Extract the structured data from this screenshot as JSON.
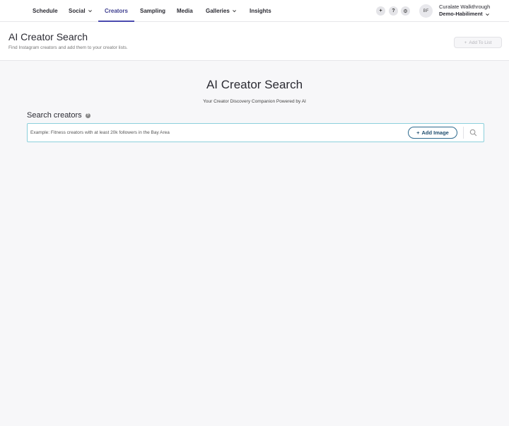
{
  "nav": {
    "items": [
      {
        "label": "Schedule"
      },
      {
        "label": "Social"
      },
      {
        "label": "Creators"
      },
      {
        "label": "Sampling"
      },
      {
        "label": "Media"
      },
      {
        "label": "Galleries"
      },
      {
        "label": "Insights"
      }
    ],
    "active": "Creators",
    "icons": {
      "plus": "+",
      "help": "?",
      "settings": "⚙"
    },
    "avatar_initials": "BF",
    "account_name": "Curalate Walkthrough",
    "account_org": "Demo-Habiliment"
  },
  "header": {
    "title": "AI Creator Search",
    "subtitle": "Find Instagram creators and add them to your creator lists.",
    "add_to_list_label": "Add To List"
  },
  "main": {
    "title": "AI Creator Search",
    "subtitle": "Your Creator Discovery Companion Powered by AI",
    "search_label": "Search creators",
    "search_placeholder": "Example: Fitness creators with at least 20k followers in the Bay Area",
    "add_image_label": "Add Image"
  },
  "colors": {
    "accent": "#4b4bb0",
    "search_border": "#8cd0dc",
    "button_border": "#2e6a8e"
  }
}
